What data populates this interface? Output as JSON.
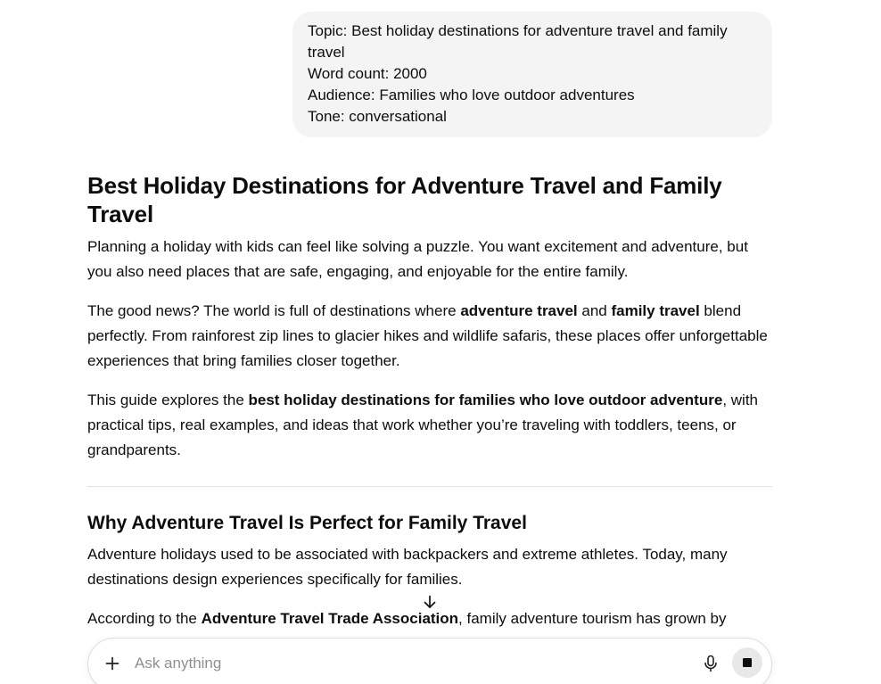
{
  "user_message": {
    "lines": [
      "Topic: Best holiday destinations for adventure travel and family travel",
      "Word count: 2000",
      "Audience: Families who love outdoor adventures",
      "Tone: conversational"
    ]
  },
  "article": {
    "title": "Best Holiday Destinations for Adventure Travel and Family Travel",
    "intro_p1": "Planning a holiday with kids can feel like solving a puzzle. You want excitement and adventure, but you also need places that are safe, engaging, and enjoyable for the entire family.",
    "intro_p2": {
      "t1": "The good news? The world is full of destinations where ",
      "b1": "adventure travel",
      "t2": " and ",
      "b2": "family travel",
      "t3": " blend perfectly. From rainforest zip lines to glacier hikes and wildlife safaris, these places offer unforgettable experiences that bring families closer together."
    },
    "intro_p3": {
      "t1": "This guide explores the ",
      "b1": "best holiday destinations for families who love outdoor adventure",
      "t2": ", with practical tips, real examples, and ideas that work whether you’re traveling with toddlers, teens, or grandparents."
    },
    "section_heading": "Why Adventure Travel Is Perfect for Family Travel",
    "section_p1": "Adventure holidays used to be associated with backpackers and extreme athletes. Today, many destinations design experiences specifically for families.",
    "section_p2": {
      "t1": "According to the ",
      "b1": "Adventure Travel Trade Association",
      "t2": ", family adventure tourism has grown by"
    }
  },
  "composer": {
    "placeholder": "Ask anything",
    "value": ""
  },
  "icons": {
    "add": "plus-icon",
    "mic": "microphone-icon",
    "stop": "stop-icon",
    "scroll": "arrow-down-icon"
  }
}
